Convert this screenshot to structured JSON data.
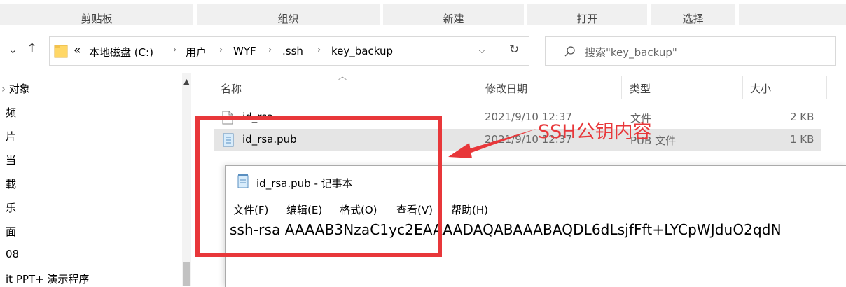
{
  "ribbon": {
    "groups": [
      {
        "label": "剪贴板"
      },
      {
        "label": "组织"
      },
      {
        "label": "新建"
      },
      {
        "label": "打开"
      },
      {
        "label": "选择"
      }
    ]
  },
  "address": {
    "overflow": "«",
    "crumbs": [
      "本地磁盘 (C:)",
      "用户",
      "WYF",
      ".ssh",
      "key_backup"
    ]
  },
  "search": {
    "placeholder": "搜索\"key_backup\""
  },
  "tree": {
    "items": [
      "对象",
      "频",
      "片",
      "当",
      "載",
      "乐",
      "面",
      "08",
      "it PPT+ 演示程序"
    ]
  },
  "columns": {
    "name": "名称",
    "date": "修改日期",
    "type": "类型",
    "size": "大小"
  },
  "files": [
    {
      "name": "id_rsa",
      "date": "2021/9/10 12:37",
      "type": "文件",
      "size": "2 KB"
    },
    {
      "name": "id_rsa.pub",
      "date": "2021/9/10 12:37",
      "type": "PUB 文件",
      "size": "1 KB"
    }
  ],
  "notepad": {
    "title": "id_rsa.pub - 记事本",
    "menu": [
      "文件(F)",
      "编辑(E)",
      "格式(O)",
      "查看(V)",
      "帮助(H)"
    ],
    "content": "ssh-rsa AAAAB3NzaC1yc2EAAAADAQABAAABAQDL6dLsjfFft+LYCpWJduO2qdN"
  },
  "annotation": {
    "label": "SSH公钥内容",
    "color": "#e8373a"
  }
}
